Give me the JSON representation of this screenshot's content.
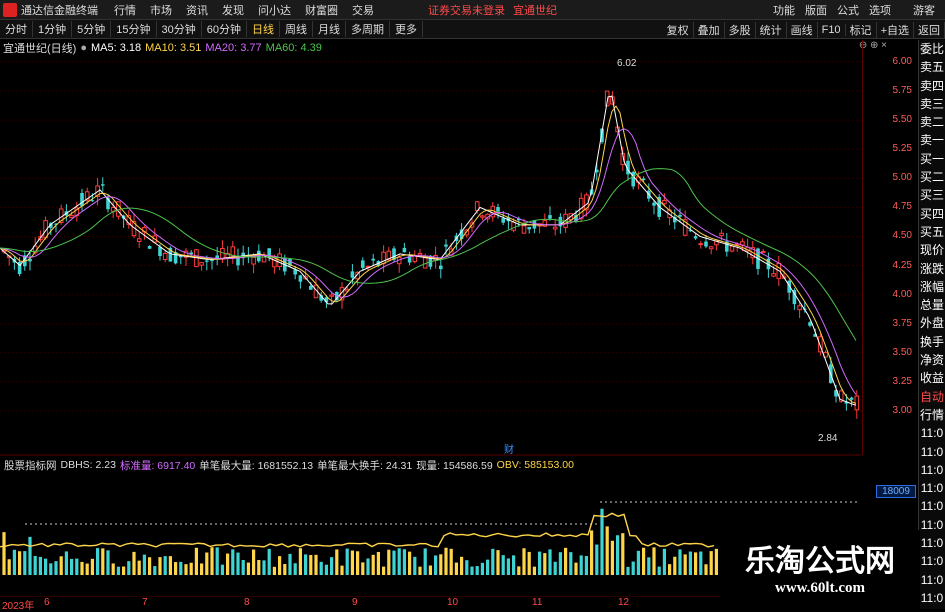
{
  "app": {
    "title": "通达信金融终端",
    "menu": [
      "行情",
      "市场",
      "资讯",
      "发现",
      "问小达",
      "财富圈",
      "交易"
    ],
    "notice": "证券交易未登录",
    "stock_link": "宜通世纪",
    "right_menu": [
      "功能",
      "版面",
      "公式",
      "选项",
      "游客"
    ]
  },
  "toolbar": {
    "periods": [
      "分时",
      "1分钟",
      "5分钟",
      "15分钟",
      "30分钟",
      "60分钟",
      "日线",
      "周线",
      "月线",
      "多周期",
      "更多"
    ],
    "active": "日线",
    "right_buttons": [
      "复权",
      "叠加",
      "多股",
      "统计",
      "画线",
      "F10",
      "标记",
      "+自选",
      "返回"
    ]
  },
  "chart_header": {
    "stock": "宜通世纪(日线)",
    "ma5": "MA5: 3.18",
    "ma10": "MA10: 3.51",
    "ma20": "MA20: 3.77",
    "ma60": "MA60: 4.39"
  },
  "price_axis": [
    "6.00",
    "5.75",
    "5.50",
    "5.25",
    "5.00",
    "4.75",
    "4.50",
    "4.25",
    "4.00",
    "3.75",
    "3.50",
    "3.25",
    "3.00"
  ],
  "annotations": {
    "high": "6.02",
    "low": "2.84",
    "cai": "财",
    "badge": "18009"
  },
  "indicator": {
    "name": "股票指标网",
    "dbhs": "DBHS: 2.23",
    "std": "标准量: 6917.40",
    "max_vol": "单笔最大量: 1681552.13",
    "max_turn": "单笔最大换手: 24.31",
    "cur_vol": "现量: 154586.59",
    "obv": "OBV: 585153.00"
  },
  "dates": [
    "2023年",
    "6",
    "7",
    "8",
    "9",
    "10",
    "11",
    "12"
  ],
  "side_panel": [
    {
      "t": "委比",
      "c": ""
    },
    {
      "t": "卖五",
      "c": ""
    },
    {
      "t": "卖四",
      "c": ""
    },
    {
      "t": "卖三",
      "c": ""
    },
    {
      "t": "卖二",
      "c": ""
    },
    {
      "t": "卖一",
      "c": ""
    },
    {
      "t": "买一",
      "c": ""
    },
    {
      "t": "买二",
      "c": ""
    },
    {
      "t": "买三",
      "c": ""
    },
    {
      "t": "买四",
      "c": ""
    },
    {
      "t": "买五",
      "c": ""
    },
    {
      "t": "现价",
      "c": ""
    },
    {
      "t": "涨跌",
      "c": ""
    },
    {
      "t": "涨幅",
      "c": ""
    },
    {
      "t": "总量",
      "c": ""
    },
    {
      "t": "外盘",
      "c": ""
    },
    {
      "t": "换手",
      "c": ""
    },
    {
      "t": "净资",
      "c": ""
    },
    {
      "t": "收益",
      "c": ""
    },
    {
      "t": "自动",
      "c": "red"
    },
    {
      "t": "行情",
      "c": ""
    },
    {
      "t": "11:0",
      "c": ""
    },
    {
      "t": "11:0",
      "c": ""
    },
    {
      "t": "11:0",
      "c": ""
    },
    {
      "t": "11:0",
      "c": ""
    },
    {
      "t": "11:0",
      "c": ""
    },
    {
      "t": "11:0",
      "c": ""
    },
    {
      "t": "11:0",
      "c": ""
    },
    {
      "t": "11:0",
      "c": ""
    },
    {
      "t": "11:0",
      "c": ""
    },
    {
      "t": "11:0",
      "c": ""
    }
  ],
  "watermark": {
    "title": "乐淘公式网",
    "url": "www.60lt.com"
  },
  "colors": {
    "up": "#ff3b3b",
    "down": "#3fd4d4",
    "ma5": "#ffffff",
    "ma10": "#ffd54a",
    "ma20": "#d36bff",
    "ma60": "#4cc44c"
  }
}
